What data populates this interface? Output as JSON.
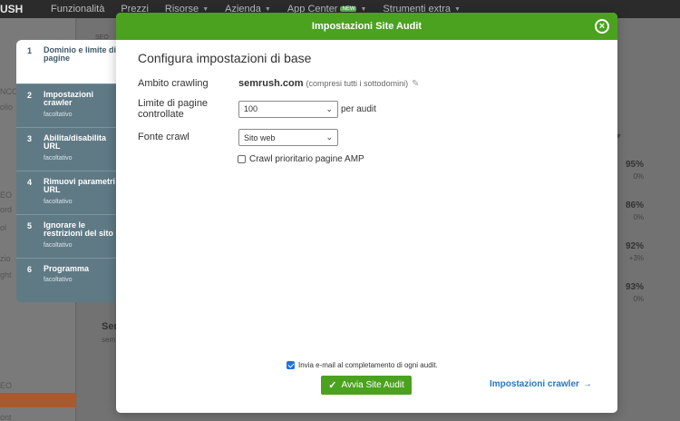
{
  "background": {
    "logo": "USH",
    "nav": [
      {
        "label": "Funzionalità",
        "has_chevron": false
      },
      {
        "label": "Prezzi",
        "has_chevron": false
      },
      {
        "label": "Risorse",
        "has_chevron": true
      },
      {
        "label": "Azienda",
        "has_chevron": true
      },
      {
        "label": "App Center",
        "has_chevron": true,
        "badge": "NEW"
      },
      {
        "label": "Strumenti extra",
        "has_chevron": true
      }
    ],
    "sidebar_fragments": [
      "NCO",
      "olio",
      "EO",
      "ord",
      "ol",
      "zio",
      "ght",
      "EO",
      "ont"
    ],
    "main": {
      "seo_tab": "SEO",
      "column_header": "ability",
      "rows": [
        {
          "value": "95%",
          "delta": "0%"
        },
        {
          "value": "86%",
          "delta": "0%"
        },
        {
          "value": "92%",
          "delta": "+3%"
        },
        {
          "value": "93%",
          "delta": "0%"
        }
      ],
      "section_title": "Sen",
      "section_sub": "sem"
    }
  },
  "stepper": [
    {
      "num": "1",
      "label": "Dominio e limite di pagine",
      "optional": "",
      "active": true
    },
    {
      "num": "2",
      "label": "Impostazioni crawler",
      "optional": "facoltativo",
      "active": false
    },
    {
      "num": "3",
      "label": "Abilita/disabilita URL",
      "optional": "facoltativo",
      "active": false
    },
    {
      "num": "4",
      "label": "Rimuovi parametri URL",
      "optional": "facoltativo",
      "active": false
    },
    {
      "num": "5",
      "label": "Ignorare le restrizioni del sito",
      "optional": "facoltativo",
      "active": false
    },
    {
      "num": "6",
      "label": "Programma",
      "optional": "facoltativo",
      "active": false
    }
  ],
  "modal": {
    "title": "Impostazioni Site Audit",
    "close_icon": "close-icon",
    "section_title": "Configura impostazioni di base",
    "crawl_scope": {
      "label": "Ambito crawling",
      "domain": "semrush.com",
      "note": "(compresi tutti i sottodomini)",
      "edit_icon": "pencil-icon"
    },
    "page_limit": {
      "label": "Limite di pagine controllate",
      "value": "100",
      "suffix": "per audit"
    },
    "crawl_source": {
      "label": "Fonte crawl",
      "value": "Sito web"
    },
    "amp_checkbox": {
      "label": "Crawl prioritario pagine AMP",
      "checked": false
    },
    "email_checkbox": {
      "label": "Invia e-mail al completamento di ogni audit.",
      "checked": true
    },
    "start_button": "Avvia Site Audit",
    "crawler_link": "Impostazioni crawler",
    "colors": {
      "header": "#4ba21e",
      "button": "#4ba21e",
      "link": "#2777c6",
      "stepper": "#5f7a85"
    }
  }
}
